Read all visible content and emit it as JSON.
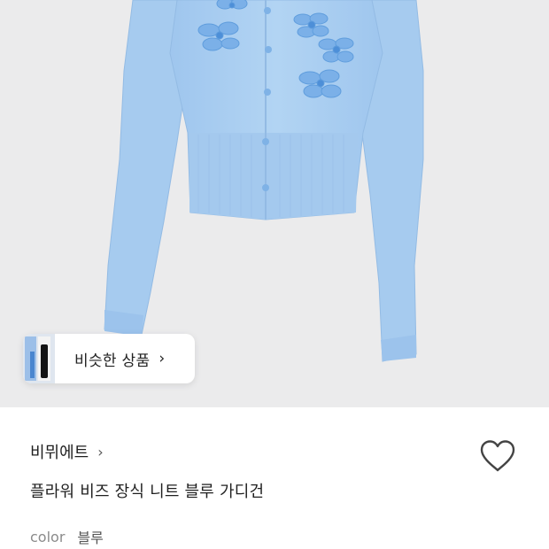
{
  "similar_chip": {
    "label": "비슷한 상품",
    "arrow": "›"
  },
  "product": {
    "brand": "비뮈에트",
    "brand_arrow": "›",
    "title": "플라워 비즈 장식 니트 블루 가디건",
    "option_label": "color",
    "option_value": "블루"
  },
  "colors": {
    "background_image": "#ebebec",
    "cardigan": "#a9cdef",
    "flower": "#7fb3e8",
    "heart_stroke": "#444444"
  },
  "icons": {
    "like": "heart-outline-icon",
    "chip_arrow": "chevron-right-icon",
    "brand_arrow": "chevron-right-icon"
  }
}
